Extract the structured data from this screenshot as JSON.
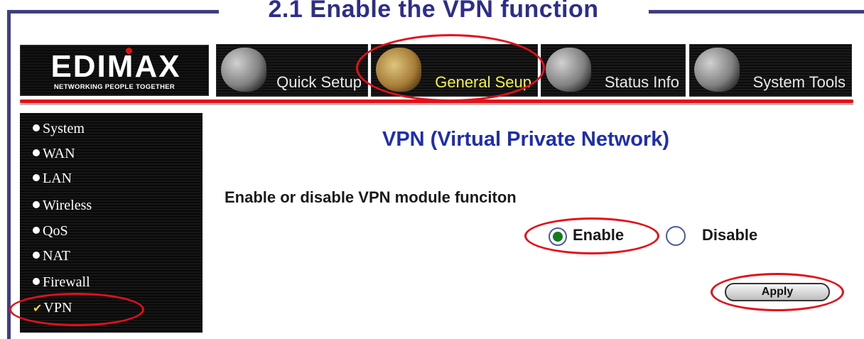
{
  "slide": {
    "title": "2.1 Enable the VPN function"
  },
  "brand": {
    "logo": "EDIMAX",
    "tagline": "NETWORKING PEOPLE TOGETHER"
  },
  "nav": {
    "tabs": [
      {
        "label": "Quick Setup",
        "icon": "quick-setup-icon"
      },
      {
        "label": "General Seup",
        "icon": "general-setup-icon",
        "active": true
      },
      {
        "label": "Status Info",
        "icon": "status-info-icon"
      },
      {
        "label": "System Tools",
        "icon": "system-tools-icon"
      }
    ]
  },
  "sidebar": {
    "items": [
      {
        "label": "System"
      },
      {
        "label": "WAN"
      },
      {
        "label": "LAN"
      },
      {
        "label": "Wireless"
      },
      {
        "label": "QoS"
      },
      {
        "label": "NAT"
      },
      {
        "label": "Firewall"
      },
      {
        "label": "VPN",
        "selected": true
      }
    ]
  },
  "content": {
    "heading": "VPN (Virtual Private Network)",
    "description": "Enable or disable VPN module funciton",
    "options": {
      "enable": "Enable",
      "disable": "Disable",
      "selected": "Enable"
    },
    "apply_label": "Apply"
  },
  "colors": {
    "frame": "#3f3f7f",
    "title": "#2e2e8a",
    "heading": "#1d2fae",
    "annotation": "#e3101a",
    "active_tab_text": "#f2f24a",
    "radio_selected": "#137b1a"
  }
}
